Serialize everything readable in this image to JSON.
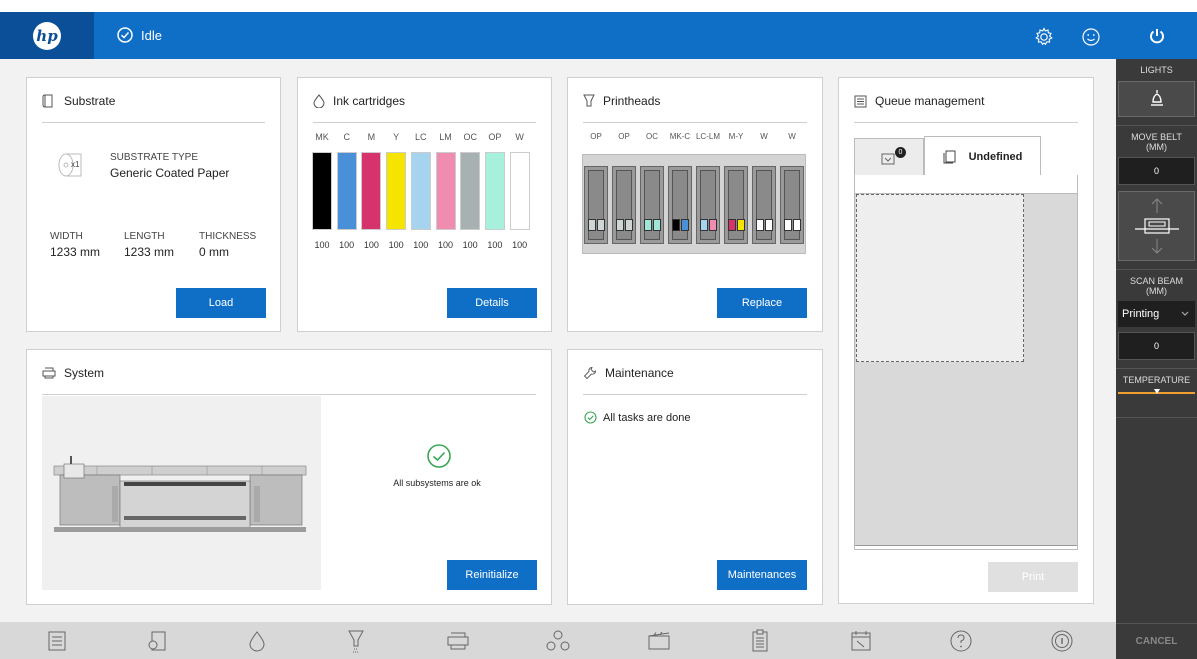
{
  "header": {
    "status": "Idle",
    "icons": [
      "hp-logo",
      "check-circle-icon",
      "gear-icon",
      "smiley-icon",
      "power-icon"
    ]
  },
  "substrate": {
    "title": "Substrate",
    "roll_count": "x1",
    "type_label": "SUBSTRATE TYPE",
    "type_value": "Generic Coated Paper",
    "width_label": "WIDTH",
    "width_value": "1233 mm",
    "length_label": "LENGTH",
    "length_value": "1233 mm",
    "thickness_label": "THICKNESS",
    "thickness_value": "0 mm",
    "button": "Load"
  },
  "ink": {
    "title": "Ink cartridges",
    "cartridges": [
      {
        "name": "MK",
        "level": "100",
        "fill": 1.0,
        "color": "#000000"
      },
      {
        "name": "C",
        "level": "100",
        "fill": 1.0,
        "color": "#4a90d9"
      },
      {
        "name": "M",
        "level": "100",
        "fill": 1.0,
        "color": "#d6336c"
      },
      {
        "name": "Y",
        "level": "100",
        "fill": 1.0,
        "color": "#f5e400"
      },
      {
        "name": "LC",
        "level": "100",
        "fill": 1.0,
        "color": "#a6d4ef"
      },
      {
        "name": "LM",
        "level": "100",
        "fill": 1.0,
        "color": "#f08cb0"
      },
      {
        "name": "OC",
        "level": "100",
        "fill": 1.0,
        "color": "#a8b1b1"
      },
      {
        "name": "OP",
        "level": "100",
        "fill": 1.0,
        "color": "#a7f0dc"
      },
      {
        "name": "W",
        "level": "100",
        "fill": 1.0,
        "color": "#ffffff"
      }
    ],
    "button": "Details"
  },
  "printheads": {
    "title": "Printheads",
    "heads": [
      {
        "name": "OP",
        "colors": [
          "#cfd6d6",
          "#cfd6d6"
        ]
      },
      {
        "name": "OP",
        "colors": [
          "#cfd6d6",
          "#cfd6d6"
        ]
      },
      {
        "name": "OC",
        "colors": [
          "#9fe6d8",
          "#9fe6d8"
        ]
      },
      {
        "name": "MK-C",
        "colors": [
          "#000000",
          "#4a90d9"
        ]
      },
      {
        "name": "LC-LM",
        "colors": [
          "#a6d4ef",
          "#f08cb0"
        ]
      },
      {
        "name": "M-Y",
        "colors": [
          "#d6336c",
          "#f5e400"
        ]
      },
      {
        "name": "W",
        "colors": [
          "#ffffff",
          "#ffffff"
        ]
      },
      {
        "name": "W",
        "colors": [
          "#ffffff",
          "#ffffff"
        ]
      }
    ],
    "button": "Replace"
  },
  "queue": {
    "title": "Queue management",
    "queue_badge": "0",
    "tab_label": "Undefined",
    "button": "Print"
  },
  "system": {
    "title": "System",
    "status_text": "All subsystems are ok",
    "button": "Reinitialize"
  },
  "maintenance": {
    "title": "Maintenance",
    "status_text": "All tasks are done",
    "button": "Maintenances"
  },
  "sidebar": {
    "lights_label": "LIGHTS",
    "move_belt_label": "MOVE BELT (MM)",
    "move_belt_value": "0",
    "scan_beam_label": "SCAN BEAM (MM)",
    "scan_beam_select": "Printing",
    "scan_beam_value": "0",
    "temperature_label": "TEMPERATURE",
    "cancel_label": "CANCEL"
  },
  "bottom_nav": [
    "list-icon",
    "substrate-roll-icon",
    "ink-drop-icon",
    "printhead-icon",
    "printer-icon",
    "network-icon",
    "clapperboard-icon",
    "clipboard-icon",
    "calendar-icon",
    "help-icon",
    "info-icon"
  ]
}
